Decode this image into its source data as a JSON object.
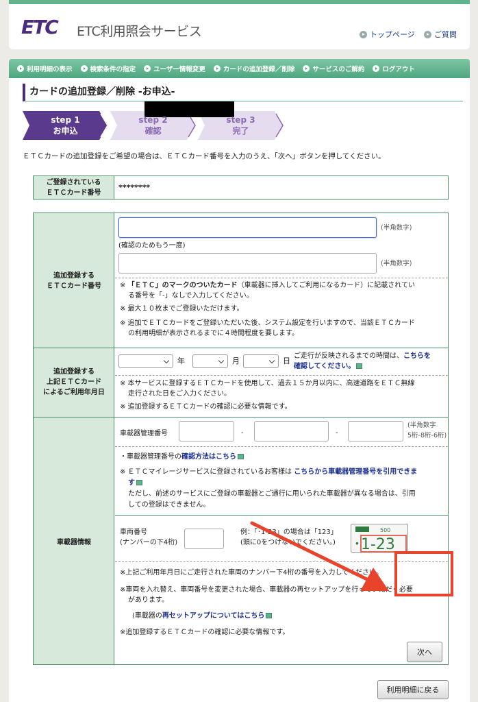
{
  "header": {
    "logo_text": "ETC",
    "service_name": "ETC利用照会サービス",
    "links": [
      {
        "label": "トップページ",
        "icon": "arrow-circle-icon"
      },
      {
        "label": "ご質問",
        "icon": "arrow-circle-icon"
      }
    ]
  },
  "nav": {
    "items": [
      {
        "label": "利用明細の表示"
      },
      {
        "label": "検索条件の指定"
      },
      {
        "label": "ユーザー情報変更"
      },
      {
        "label": "カードの追加登録／削除"
      },
      {
        "label": "サービスのご解約"
      },
      {
        "label": "ログアウト"
      }
    ]
  },
  "page_title": "カードの追加登録／削除 -お申込-",
  "steps": [
    {
      "num": "step 1",
      "label": "お申込",
      "active": true
    },
    {
      "num": "step 2",
      "label": "確認",
      "active": false
    },
    {
      "num": "step 3",
      "label": "完了",
      "active": false
    }
  ],
  "intro": "ＥＴＣカードの追加登録をご希望の場合は、ＥＴＣカード番号を入力のうえ、「次へ」ボタンを押してください。",
  "registered": {
    "label_line1": "ご登録されている",
    "label_line2": "ＥＴＣカード番号",
    "value": "********"
  },
  "card_section": {
    "label_line1": "追加登録する",
    "label_line2": "ＥＴＣカード番号",
    "hint": "(半角数字)",
    "confirm_label": "(確認のためもう一度)",
    "notes": {
      "n1_mark": "※",
      "n1_bold": "「ＥＴＣ」のマークのついたカード",
      "n1_rest": "（車載器に挿入してご利用になるカード）に記載されてい",
      "n1_line2": "る番号を「-」なしで入力してください。",
      "n2": "※ 最大１０枚までご登録いただけます。",
      "n3_line1": "※ 追加でＥＴＣカードをご登録いただいた後、システム設定を行いますので、当該ＥＴＣカード",
      "n3_line2": "の利用明細が表示されるまでに４時間程度を要します。"
    }
  },
  "date_section": {
    "label_line1": "追加登録する",
    "label_line2": "上記ＥＴＣカード",
    "label_line3": "によるご利用年月日",
    "year_unit": "年",
    "month_unit": "月",
    "day_unit": "日",
    "side_note_pre": "ご走行が反映されるまでの時間は、",
    "side_note_link1": "こちらを",
    "side_note_link2": "確認してください。",
    "note1_line1": "※ 本サービスに登録するＥＴＣカードを使用して、過去１５か月以内に、高速道路をＥＴＣ無線",
    "note1_line2": "走行された日をご入力ください。",
    "note2": "※ 追加登録するＥＴＣカードの確認に必要な情報です。"
  },
  "device_section": {
    "label": "車載器情報",
    "mgmt_label": "車載器管理番号",
    "dash": "-",
    "mgmt_hint1": "(半角数字",
    "mgmt_hint2": "5桁-8桁-6桁)",
    "check_pre": "・車載器管理番号の",
    "check_link": "確認方法はこちら",
    "mileage_pre": "※ ＥＴＣマイレージサービスに登録されているお客様は",
    "mileage_link1": "こちらから車載器管理番号を引用できま",
    "mileage_link2": "す",
    "mileage_line3": "ただし、前述のサービスにご登録の車載器とご通行に用いられた車載器が異なる場合は、引用",
    "mileage_line4": "しての登録はできません。",
    "plate_label1": "車両番号",
    "plate_label2": "(ナンバーの下4桁)",
    "example_line1": "例：「･1-23」の場合は「123」",
    "example_line2": "(頭に0をつけないでください。)",
    "plate_image_top": "500",
    "plate_image_num": "･1-23",
    "note1": "※上記ご利用年月日にご走行された車両のナンバー下4桁の番号を入力してください。",
    "note2_line1": "※車両を入れ替え、車両番号を変更された場合、車載器の再セットアップを行っていただく必要",
    "note2_line2": "があります。",
    "note3_pre": "(車載器の",
    "note3_link": "再セットアップについてはこちら",
    "note4": "※追加登録するＥＴＣカードの確認に必要な情報です。"
  },
  "buttons": {
    "next": "次へ",
    "back": "利用明細に戻る"
  },
  "colors": {
    "accent_green": "#5fb48e",
    "step_active": "#5a3a8c",
    "step_inactive": "#e6dcef",
    "highlight": "#e8432b"
  }
}
